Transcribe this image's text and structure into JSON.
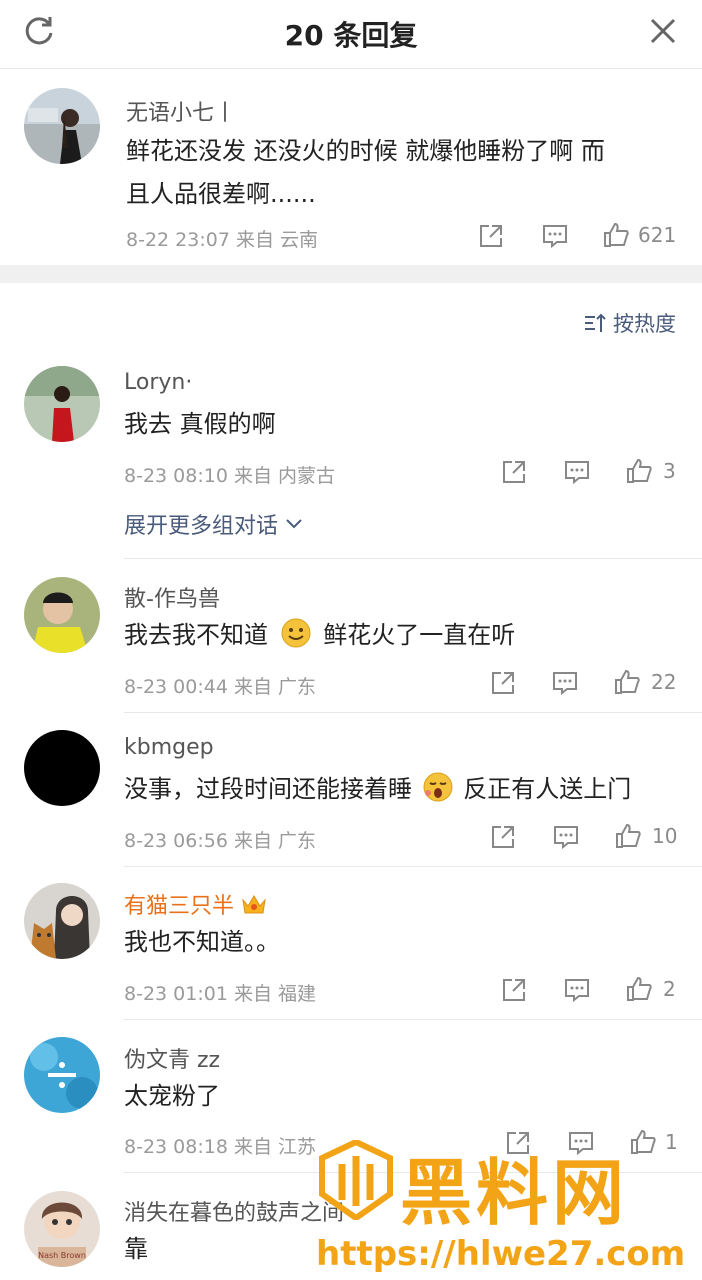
{
  "header": {
    "title": "20 条回复"
  },
  "main_comment": {
    "name": "无语小七丨",
    "text_line1": "鲜花还没发 还没火的时候 就爆他睡粉了啊 而",
    "text_line2": "且人品很差啊......",
    "meta": "8-22 23:07  来自 云南",
    "likes": "621"
  },
  "sort_label": "按热度",
  "expand_label": "展开更多组对话",
  "replies": [
    {
      "name": "Loryn·",
      "text": "我去 真假的啊",
      "meta": "8-23 08:10  来自 内蒙古",
      "likes": "3"
    },
    {
      "name": "散-作鸟兽",
      "text_a": "我去我不知道",
      "text_b": "鲜花火了一直在听",
      "meta": "8-23 00:44  来自 广东",
      "likes": "22"
    },
    {
      "name": "kbmgep",
      "text_a": "没事，过段时间还能接着睡",
      "text_b": "反正有人送上门",
      "meta": "8-23 06:56  来自 广东",
      "likes": "10"
    },
    {
      "name": "有猫三只半",
      "text": "我也不知道。。",
      "meta": "8-23 01:01  来自 福建",
      "likes": "2",
      "name_color": "#e8721c"
    },
    {
      "name": "伪文青 zz",
      "text": "太宠粉了",
      "meta": "8-23 08:18  来自 江苏",
      "likes": "1"
    },
    {
      "name": "消失在暮色的鼓声之间",
      "text": "靠"
    }
  ],
  "watermark": {
    "title": "黑料网",
    "url": "https://hlwe27.com"
  },
  "avatar_texts": {
    "r6": "Nash Brown"
  },
  "colors": {
    "link": "#4a5b7c",
    "vip_name": "#e8721c",
    "watermark": "#f2a416"
  }
}
